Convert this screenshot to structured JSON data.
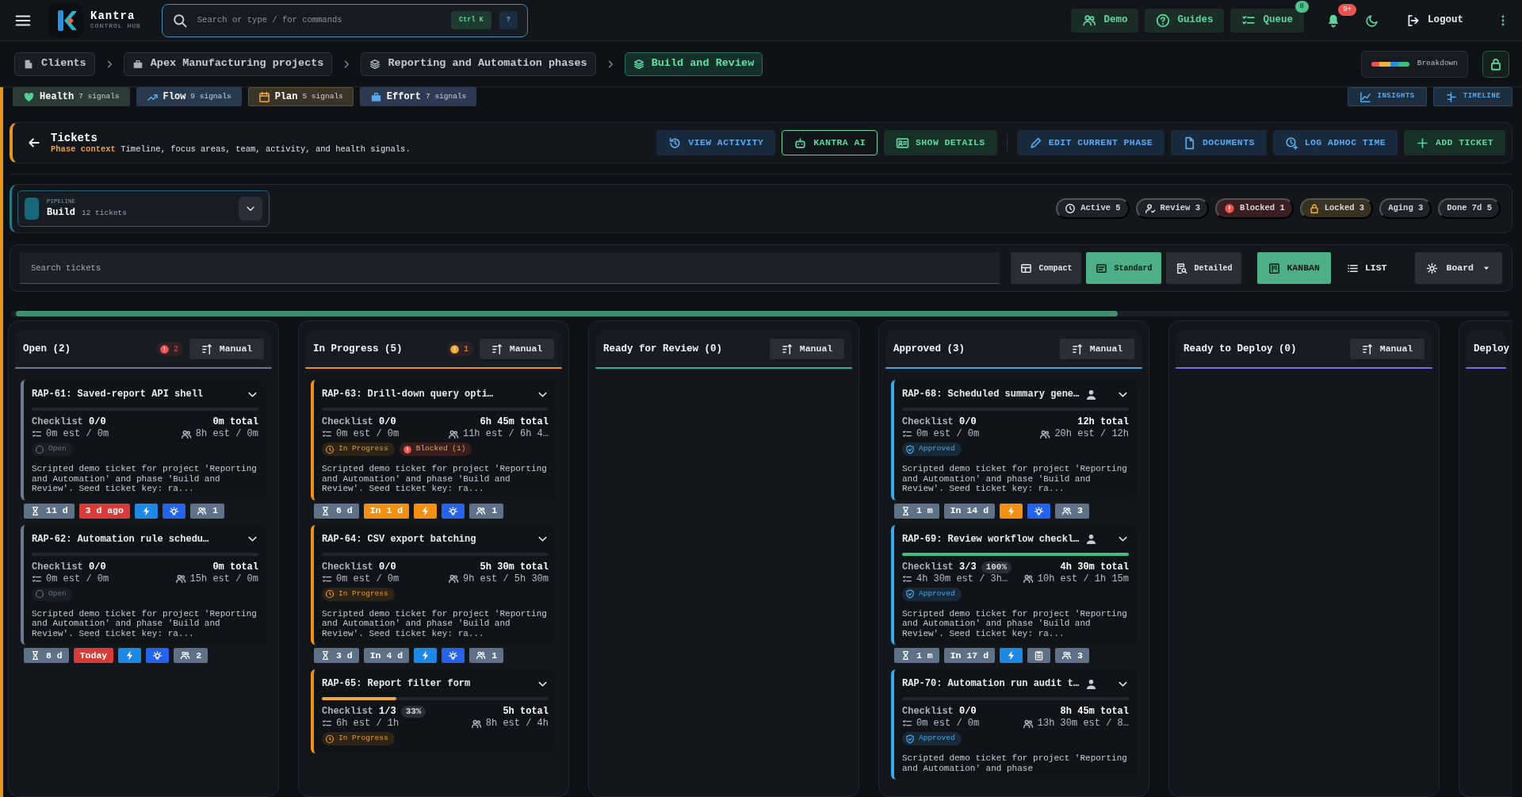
{
  "app": {
    "name": "Kantra",
    "subtitle": "CONTROL HUB"
  },
  "command_search": {
    "placeholder": "Search or type / for commands",
    "shortcut": "Ctrl K",
    "help": "?"
  },
  "top_actions": [
    {
      "kind": "demo",
      "label": "Demo"
    },
    {
      "kind": "guides",
      "label": "Guides"
    },
    {
      "kind": "queue",
      "label": "Queue",
      "badge": "8"
    }
  ],
  "notifications": {
    "badge": "9+"
  },
  "logout": {
    "label": "Logout"
  },
  "breadcrumbs": [
    {
      "kind": "client",
      "label": "Clients",
      "selected": false
    },
    {
      "kind": "project",
      "label": "Apex Manufacturing projects",
      "selected": false
    },
    {
      "kind": "phase",
      "label": "Reporting and Automation phases",
      "selected": false
    },
    {
      "kind": "phase",
      "label": "Build and Review",
      "selected": true
    }
  ],
  "breakdown": {
    "label": "Breakdown"
  },
  "signals": [
    {
      "kind": "health",
      "label": "Health",
      "count": "7 signals"
    },
    {
      "kind": "flow",
      "label": "Flow",
      "count": "9 signals"
    },
    {
      "kind": "plan",
      "label": "Plan",
      "count": "5 signals"
    },
    {
      "kind": "effort",
      "label": "Effort",
      "count": "7 signals"
    }
  ],
  "views": [
    {
      "kind": "insights",
      "label": "INSIGHTS"
    },
    {
      "kind": "timeline",
      "label": "TIMELINE"
    }
  ],
  "header": {
    "title": "Tickets",
    "context_label": "Phase context",
    "context_text": "Timeline, focus areas, team, activity, and health signals."
  },
  "actions": [
    {
      "kind": "activity",
      "label": "VIEW ACTIVITY"
    },
    {
      "kind": "ai",
      "label": "KANTRA AI"
    },
    {
      "kind": "details",
      "label": "SHOW DETAILS"
    },
    {
      "kind": "edit",
      "label": "EDIT CURRENT PHASE"
    },
    {
      "kind": "documents",
      "label": "DOCUMENTS"
    },
    {
      "kind": "time",
      "label": "LOG ADHOC TIME"
    },
    {
      "kind": "add",
      "label": "ADD TICKET"
    }
  ],
  "pipeline": {
    "label": "PIPELINE",
    "name": "Build",
    "count": "12 tickets"
  },
  "stats": [
    {
      "kind": "active",
      "label": "Active 5"
    },
    {
      "kind": "review",
      "label": "Review 3"
    },
    {
      "kind": "blocked",
      "label": "Blocked 1"
    },
    {
      "kind": "locked",
      "label": "Locked 3"
    },
    {
      "kind": "aging",
      "label": "Aging 3"
    },
    {
      "kind": "done",
      "label": "Done 7d 5"
    }
  ],
  "ticket_search": {
    "placeholder": "Search tickets"
  },
  "densities": [
    {
      "kind": "compact",
      "label": "Compact",
      "selected": false
    },
    {
      "kind": "standard",
      "label": "Standard",
      "selected": true
    },
    {
      "kind": "detailed",
      "label": "Detailed",
      "selected": false
    }
  ],
  "layouts": [
    {
      "kind": "kanban",
      "label": "KANBAN",
      "selected": true
    },
    {
      "kind": "list",
      "label": "LIST",
      "selected": false
    }
  ],
  "board_menu": {
    "label": "Board"
  },
  "columns": [
    {
      "title": "Open (2)",
      "color": "#6b7a8f",
      "alert": {
        "kind": "blocked",
        "count": "2"
      },
      "sort": "Manual",
      "cards": [
        {
          "title": "RAP-61: Saved-report API shell",
          "assigned": false,
          "level": 0,
          "checklist_label": "Checklist",
          "checklist": "0/0",
          "total": "0m total",
          "est": "0m est / 0m",
          "team_est": "8h est / 0m",
          "statuses": [
            {
              "kind": "open",
              "label": "Open"
            }
          ],
          "description": "Scripted demo ticket for project 'Reporting and Automation' and phase 'Build and Review'. Seed ticket key: ra...",
          "chips": [
            {
              "kind": "age",
              "label": "11 d"
            },
            {
              "kind": "due",
              "label": "3 d ago",
              "color": "#d93b3b"
            },
            {
              "kind": "priority",
              "color": "#1e88e5"
            },
            {
              "kind": "idea",
              "color": "#2563eb"
            },
            {
              "kind": "team",
              "label": "1"
            }
          ]
        },
        {
          "title": "RAP-62: Automation rule schedu…",
          "assigned": false,
          "level": 0,
          "checklist_label": "Checklist",
          "checklist": "0/0",
          "total": "0m total",
          "est": "0m est / 0m",
          "team_est": "15h est / 0m",
          "statuses": [
            {
              "kind": "open",
              "label": "Open"
            }
          ],
          "description": "Scripted demo ticket for project 'Reporting and Automation' and phase 'Build and Review'. Seed ticket key: ra...",
          "chips": [
            {
              "kind": "age",
              "label": "8 d"
            },
            {
              "kind": "due",
              "label": "Today",
              "color": "#d93b3b"
            },
            {
              "kind": "priority",
              "color": "#1e88e5"
            },
            {
              "kind": "idea",
              "color": "#2563eb"
            },
            {
              "kind": "team",
              "label": "2"
            }
          ]
        }
      ]
    },
    {
      "title": "In Progress (5)",
      "color": "#f29111",
      "alert": {
        "kind": "warning",
        "count": "1"
      },
      "sort": "Manual",
      "cards": [
        {
          "title": "RAP-63: Drill-down query opti…",
          "assigned": false,
          "level": 0,
          "checklist_label": "Checklist",
          "checklist": "0/0",
          "total": "6h 45m total",
          "est": "0m est / 0m",
          "team_est": "11h est / 6h 4…",
          "statuses": [
            {
              "kind": "in_progress",
              "label": "In Progress"
            },
            {
              "kind": "blocked",
              "label": "Blocked (1)"
            }
          ],
          "description": "Scripted demo ticket for project 'Reporting and Automation' and phase 'Build and Review'. Seed ticket key: ra...",
          "chips": [
            {
              "kind": "age",
              "label": "6 d"
            },
            {
              "kind": "due",
              "label": "In 1 d",
              "color": "#f29111"
            },
            {
              "kind": "priority",
              "color": "#f29111"
            },
            {
              "kind": "idea",
              "color": "#2563eb"
            },
            {
              "kind": "team",
              "label": "1"
            }
          ]
        },
        {
          "title": "RAP-64: CSV export batching",
          "assigned": false,
          "level": 0,
          "checklist_label": "Checklist",
          "checklist": "0/0",
          "total": "5h 30m total",
          "est": "0m est / 0m",
          "team_est": "9h est / 5h 30m",
          "statuses": [
            {
              "kind": "in_progress",
              "label": "In Progress"
            }
          ],
          "description": "Scripted demo ticket for project 'Reporting and Automation' and phase 'Build and Review'. Seed ticket key: ra...",
          "chips": [
            {
              "kind": "age",
              "label": "3 d"
            },
            {
              "kind": "due",
              "label": "In 4 d",
              "color": "#5f7186"
            },
            {
              "kind": "priority",
              "color": "#1e88e5"
            },
            {
              "kind": "idea",
              "color": "#2563eb"
            },
            {
              "kind": "team",
              "label": "1"
            }
          ]
        },
        {
          "title": "RAP-65: Report filter form",
          "assigned": false,
          "level": 0.33,
          "percent": "33%",
          "checklist_label": "Checklist",
          "checklist": "1/3",
          "total": "5h total",
          "est": "6h est / 1h",
          "team_est": "8h est / 4h",
          "statuses": [
            {
              "kind": "in_progress",
              "label": "In Progress"
            }
          ]
        }
      ]
    },
    {
      "title": "Ready for Review (0)",
      "color": "#2bb3a0",
      "sort": "Manual"
    },
    {
      "title": "Approved (3)",
      "color": "#3aa7e8",
      "sort": "Manual",
      "cards": [
        {
          "title": "RAP-68: Scheduled summary gene…",
          "assigned": true,
          "level": 0,
          "checklist_label": "Checklist",
          "checklist": "0/0",
          "total": "12h total",
          "est": "0m est / 0m",
          "team_est": "20h est / 12h",
          "statuses": [
            {
              "kind": "approved",
              "label": "Approved"
            }
          ],
          "description": "Scripted demo ticket for project 'Reporting and Automation' and phase 'Build and Review'. Seed ticket key: ra...",
          "chips": [
            {
              "kind": "age",
              "label": "1 m"
            },
            {
              "kind": "due",
              "label": "In 14 d",
              "color": "#5f7186"
            },
            {
              "kind": "priority",
              "color": "#f29111"
            },
            {
              "kind": "idea",
              "color": "#2563eb"
            },
            {
              "kind": "team",
              "label": "3"
            }
          ]
        },
        {
          "title": "RAP-69: Review workflow checkl…",
          "assigned": true,
          "level": 1,
          "percent": "100%",
          "checklist_label": "Checklist",
          "checklist": "3/3",
          "total": "4h 30m total",
          "est": "4h 30m est / 3h…",
          "team_est": "10h est / 1h 15m",
          "statuses": [
            {
              "kind": "approved",
              "label": "Approved"
            }
          ],
          "description": "Scripted demo ticket for project 'Reporting and Automation' and phase 'Build and Review'. Seed ticket key: ra...",
          "chips": [
            {
              "kind": "age",
              "label": "1 m"
            },
            {
              "kind": "due",
              "label": "In 17 d",
              "color": "#5f7186"
            },
            {
              "kind": "priority",
              "color": "#1e88e5"
            },
            {
              "kind": "task",
              "color": "#5f7186"
            },
            {
              "kind": "team",
              "label": "3"
            }
          ]
        },
        {
          "title": "RAP-70: Automation run audit t…",
          "assigned": true,
          "level": 0,
          "checklist_label": "Checklist",
          "checklist": "0/0",
          "total": "8h 45m total",
          "est": "0m est / 0m",
          "team_est": "13h 30m est / 8…",
          "statuses": [
            {
              "kind": "approved",
              "label": "Approved"
            }
          ],
          "description": "Scripted demo ticket for project 'Reporting and Automation' and phase"
        }
      ]
    },
    {
      "title": "Ready to Deploy (0)",
      "color": "#7b6cf0",
      "sort": "Manual"
    },
    {
      "title": "Deploy",
      "color": "#7b6cf0"
    }
  ]
}
